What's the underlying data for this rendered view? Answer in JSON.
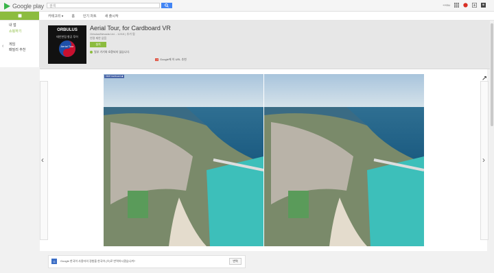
{
  "brand": {
    "logo_text": "Google play"
  },
  "search": {
    "placeholder": "검색"
  },
  "topbar": {
    "user_label": "+YOU"
  },
  "nav": {
    "apps_label": "앱",
    "items": [
      "카테고리 ▾",
      "홈",
      "인기 차트",
      "새 출시작"
    ]
  },
  "left_panel": {
    "items": [
      "내 앱",
      "쇼핑하기",
      "게임",
      "패밀리 추천"
    ]
  },
  "app": {
    "icon_text": {
      "line1": "ORBULUS",
      "line2": "태안한림 항공 투어",
      "line3": "Aerial Tour"
    },
    "title": "Aerial Tour, for Cardboard VR",
    "developer": "Orbulus/Nevada Ltd. - 12/15 | 추가 됨",
    "rating_text": "연령 제한 없음",
    "install_label": "설치",
    "compat_text": "일부 기기와 호환되지 않습니다.",
    "gplus_label": "+1",
    "gplus_text": "Google에 이 URL 추천"
  },
  "screenshot": {
    "tag_label": "VRiP Cardboard ◀"
  },
  "notice": {
    "text": "Google 한국어 사용자의 경험을 한국어 (으)로 번역하시겠습니까?",
    "button": "번역"
  },
  "colors": {
    "accent": "#8cbc3f",
    "search_button": "#4285f4",
    "info_icon": "#3b6dc5"
  }
}
